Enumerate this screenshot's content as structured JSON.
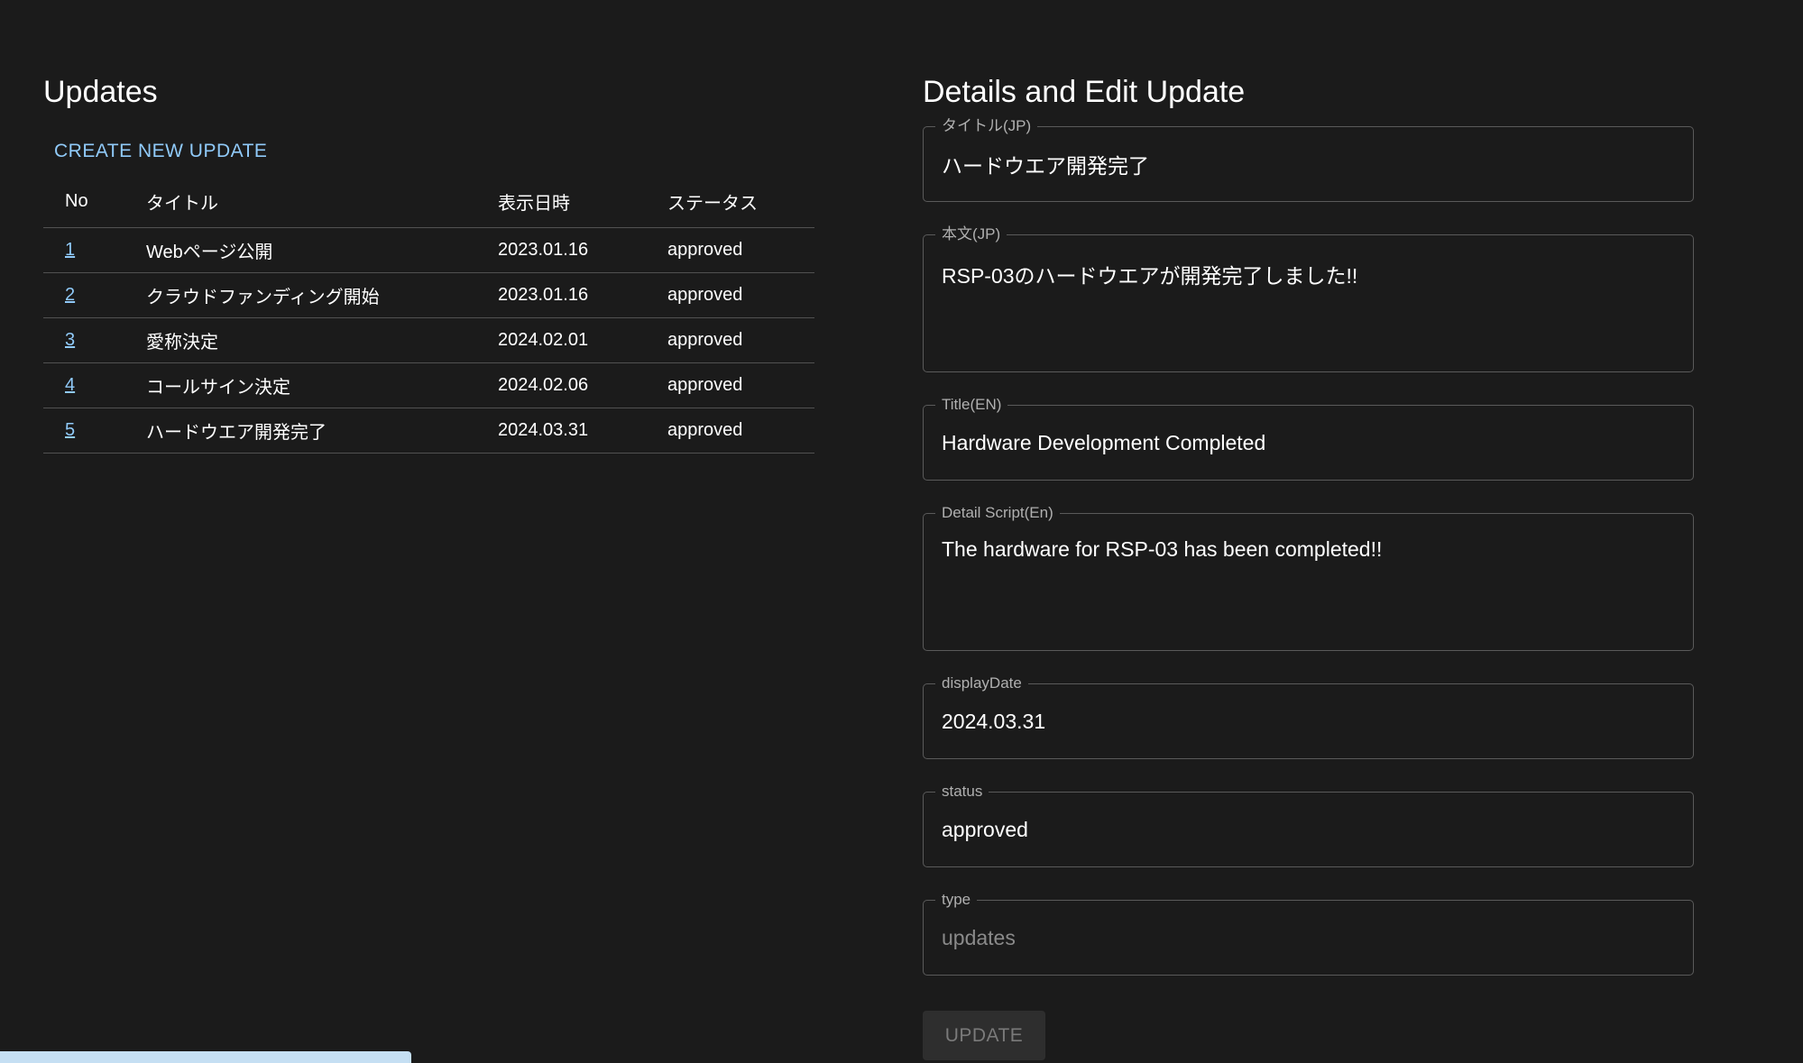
{
  "left": {
    "heading": "Updates",
    "create_label": "CREATE NEW UPDATE",
    "columns": {
      "no": "No",
      "title": "タイトル",
      "date": "表示日時",
      "status": "ステータス"
    },
    "rows": [
      {
        "no": "1",
        "title": "Webページ公開",
        "date": "2023.01.16",
        "status": "approved"
      },
      {
        "no": "2",
        "title": "クラウドファンディング開始",
        "date": "2023.01.16",
        "status": "approved"
      },
      {
        "no": "3",
        "title": "愛称決定",
        "date": "2024.02.01",
        "status": "approved"
      },
      {
        "no": "4",
        "title": "コールサイン決定",
        "date": "2024.02.06",
        "status": "approved"
      },
      {
        "no": "5",
        "title": "ハードウエア開発完了",
        "date": "2024.03.31",
        "status": "approved"
      }
    ]
  },
  "right": {
    "heading": "Details and Edit Update",
    "fields": {
      "title_jp": {
        "label": "タイトル(JP)",
        "value": "ハードウエア開発完了"
      },
      "body_jp": {
        "label": "本文(JP)",
        "value": "RSP-03のハードウエアが開発完了しました!!"
      },
      "title_en": {
        "label": "Title(EN)",
        "value": "Hardware Development Completed"
      },
      "detail_en": {
        "label": "Detail Script(En)",
        "value": "The hardware for RSP-03 has been completed!!"
      },
      "display_date": {
        "label": "displayDate",
        "value": "2024.03.31"
      },
      "status": {
        "label": "status",
        "value": "approved"
      },
      "type": {
        "label": "type",
        "value": "updates"
      }
    },
    "update_label": "UPDATE"
  },
  "colors": {
    "background": "#1b1b1b",
    "link": "#90caf9",
    "border": "#5a5a5a"
  }
}
